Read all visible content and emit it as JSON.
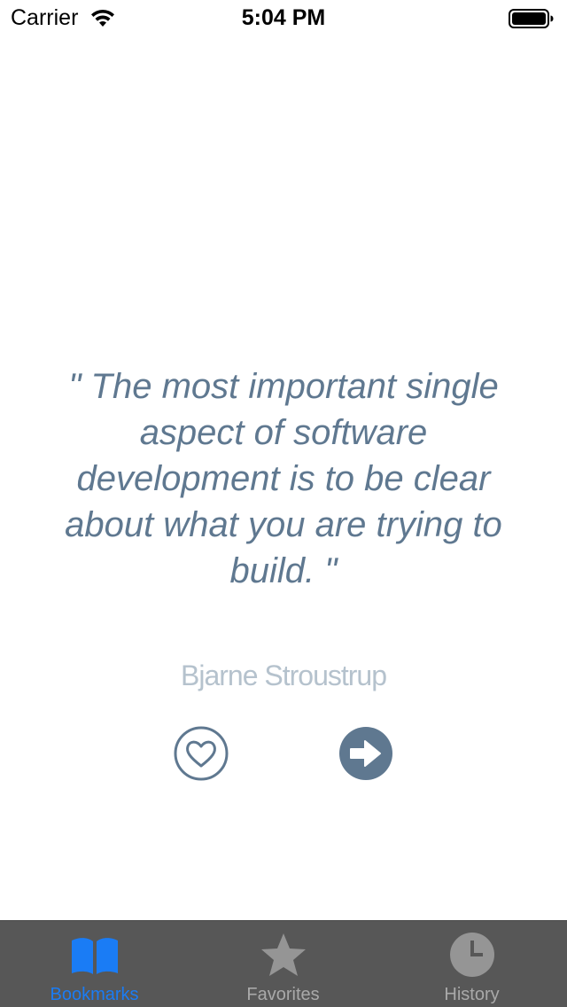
{
  "status_bar": {
    "carrier": "Carrier",
    "time": "5:04 PM",
    "wifi_icon": "wifi-icon",
    "battery_icon": "battery-icon"
  },
  "quote": {
    "text": "\" The most important single aspect of software development is to be clear about what you are trying to build. \"",
    "author": "Bjarne Stroustrup"
  },
  "actions": {
    "favorite_icon": "heart-icon",
    "next_icon": "arrow-right-icon"
  },
  "tabs": [
    {
      "label": "Bookmarks",
      "icon": "book-icon",
      "active": true
    },
    {
      "label": "Favorites",
      "icon": "star-icon",
      "active": false
    },
    {
      "label": "History",
      "icon": "clock-icon",
      "active": false
    }
  ],
  "colors": {
    "quote": "#5f7890",
    "author": "#b5c2cd",
    "accent": "#1a7cf5",
    "tab_bar": "#575757",
    "tab_inactive": "#a9a9a9",
    "icon_dark": "#5f7890"
  }
}
